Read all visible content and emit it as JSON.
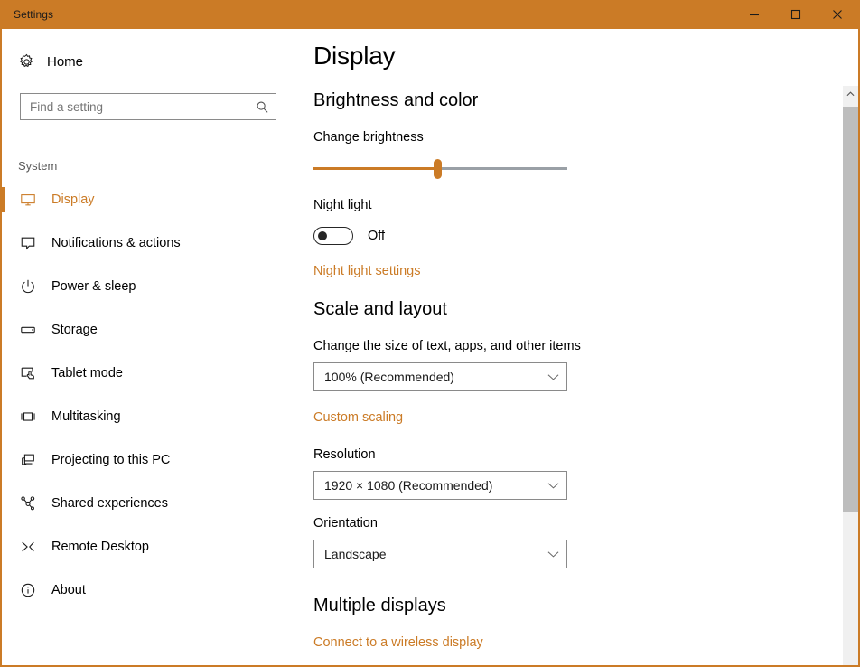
{
  "window": {
    "title": "Settings",
    "accent_color": "#CB7B26",
    "controls": {
      "minimize": "Minimize",
      "maximize": "Maximize",
      "close": "Close"
    }
  },
  "sidebar": {
    "home_label": "Home",
    "search": {
      "placeholder": "Find a setting",
      "value": ""
    },
    "group_label": "System",
    "items": [
      {
        "label": "Display",
        "icon": "monitor-icon",
        "selected": true
      },
      {
        "label": "Notifications & actions",
        "icon": "speech-bubble-icon",
        "selected": false
      },
      {
        "label": "Power & sleep",
        "icon": "power-icon",
        "selected": false
      },
      {
        "label": "Storage",
        "icon": "drive-icon",
        "selected": false
      },
      {
        "label": "Tablet mode",
        "icon": "tablet-touch-icon",
        "selected": false
      },
      {
        "label": "Multitasking",
        "icon": "multitask-icon",
        "selected": false
      },
      {
        "label": "Projecting to this PC",
        "icon": "projecting-icon",
        "selected": false
      },
      {
        "label": "Shared experiences",
        "icon": "share-nodes-icon",
        "selected": false
      },
      {
        "label": "Remote Desktop",
        "icon": "remote-desktop-icon",
        "selected": false
      },
      {
        "label": "About",
        "icon": "info-circle-icon",
        "selected": false
      }
    ]
  },
  "main": {
    "page_title": "Display",
    "brightness_section": {
      "heading": "Brightness and color",
      "brightness_label": "Change brightness",
      "brightness_percent": 49,
      "night_light_label": "Night light",
      "night_light_state": "Off",
      "night_light_on": false,
      "night_light_settings_link": "Night light settings"
    },
    "scale_section": {
      "heading": "Scale and layout",
      "scale_label": "Change the size of text, apps, and other items",
      "scale_value": "100% (Recommended)",
      "custom_scaling_link": "Custom scaling",
      "resolution_label": "Resolution",
      "resolution_value": "1920 × 1080 (Recommended)",
      "orientation_label": "Orientation",
      "orientation_value": "Landscape"
    },
    "multiple_displays_section": {
      "heading": "Multiple displays",
      "wireless_link": "Connect to a wireless display"
    }
  },
  "scrollbar": {
    "up_arrow": "scroll-up"
  }
}
